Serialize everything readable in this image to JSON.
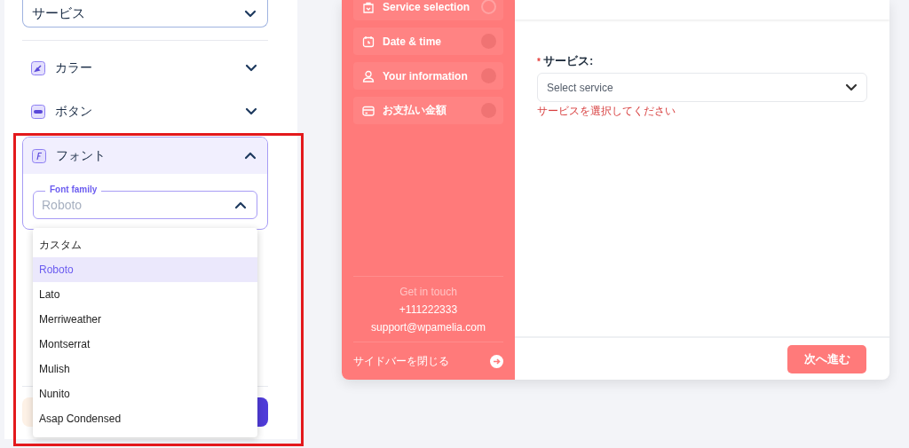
{
  "settings_panel": {
    "step_select": {
      "value": "サービス"
    },
    "sections": [
      {
        "label": "カラー",
        "kind": "color",
        "expanded": false
      },
      {
        "label": "ボタン",
        "kind": "button",
        "expanded": false
      },
      {
        "label": "フォント",
        "kind": "font",
        "expanded": true,
        "field": {
          "label": "Font family",
          "value": "Roboto",
          "open": true
        }
      }
    ]
  },
  "font_dropdown": {
    "options": [
      {
        "label": "カスタム",
        "selected": false
      },
      {
        "label": "Roboto",
        "selected": true
      },
      {
        "label": "Lato",
        "selected": false
      },
      {
        "label": "Merriweather",
        "selected": false
      },
      {
        "label": "Montserrat",
        "selected": false
      },
      {
        "label": "Mulish",
        "selected": false
      },
      {
        "label": "Nunito",
        "selected": false
      },
      {
        "label": "Asap Condensed",
        "selected": false
      }
    ]
  },
  "booking_form": {
    "steps": [
      {
        "label": "Service selection",
        "kind": "bag",
        "selected": true
      },
      {
        "label": "Date & time",
        "kind": "calendar",
        "selected": false
      },
      {
        "label": "Your information",
        "kind": "user",
        "selected": false
      },
      {
        "label": "お支払い金額",
        "kind": "card",
        "selected": false
      }
    ],
    "contact": {
      "heading": "Get in touch",
      "phone": "+111222333",
      "email": "support@wpamelia.com"
    },
    "close_sidebar": "サイドバーを閉じる",
    "service_field": {
      "label": "サービス:",
      "required_mark": "*",
      "placeholder": "Select service",
      "error": "サービスを選択してください"
    },
    "next_button": "次へ進む"
  }
}
